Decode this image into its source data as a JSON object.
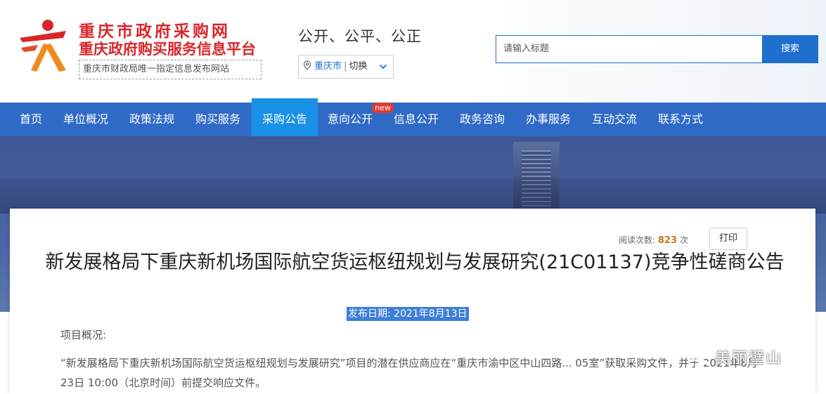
{
  "header": {
    "site_title": "重庆市政府采购网",
    "site_subtitle": "重庆政府购买服务信息平台",
    "site_tagline": "重庆市财政局唯一指定信息发布网站",
    "slogan": "公开、公平、公正",
    "city": "重庆市",
    "city_separator": "|",
    "city_switch": "切换",
    "search_placeholder": "请输入标题",
    "search_button": "搜索"
  },
  "nav": {
    "items": [
      {
        "label": "首页"
      },
      {
        "label": "单位概况"
      },
      {
        "label": "政策法规"
      },
      {
        "label": "购买服务"
      },
      {
        "label": "采购公告"
      },
      {
        "label": "意向公开"
      },
      {
        "label": "信息公开"
      },
      {
        "label": "政务咨询"
      },
      {
        "label": "办事服务"
      },
      {
        "label": "互动交流"
      },
      {
        "label": "联系方式"
      }
    ],
    "active_index": 4,
    "new_badge": "new"
  },
  "article": {
    "reads_label": "阅读次数:",
    "reads_count": "823",
    "reads_unit": "次",
    "print_button": "打印",
    "title": "新发展格局下重庆新机场国际航空货运枢纽规划与发展研究(21C01137)竞争性磋商公告",
    "publish_date": "发布日期:   2021年8月13日",
    "overview_label": "项目概况:",
    "body": "“新发展格局下重庆新机场国际航空货运枢纽规划与发展研究”项目的潜在供应商应在“重庆市渝中区中山四路... 05室”获取采购文件，并于 2021年8月23日 10:00（北京时间）前提交响应文件。"
  },
  "watermark": {
    "text": "美丽璧山"
  },
  "colors": {
    "brand_red": "#d8262b",
    "nav_blue": "#2f6bc6",
    "nav_active": "#1891e6",
    "search_blue": "#1f6fcf",
    "reads_orange": "#c47a18",
    "badge_red": "#e03a2f"
  }
}
